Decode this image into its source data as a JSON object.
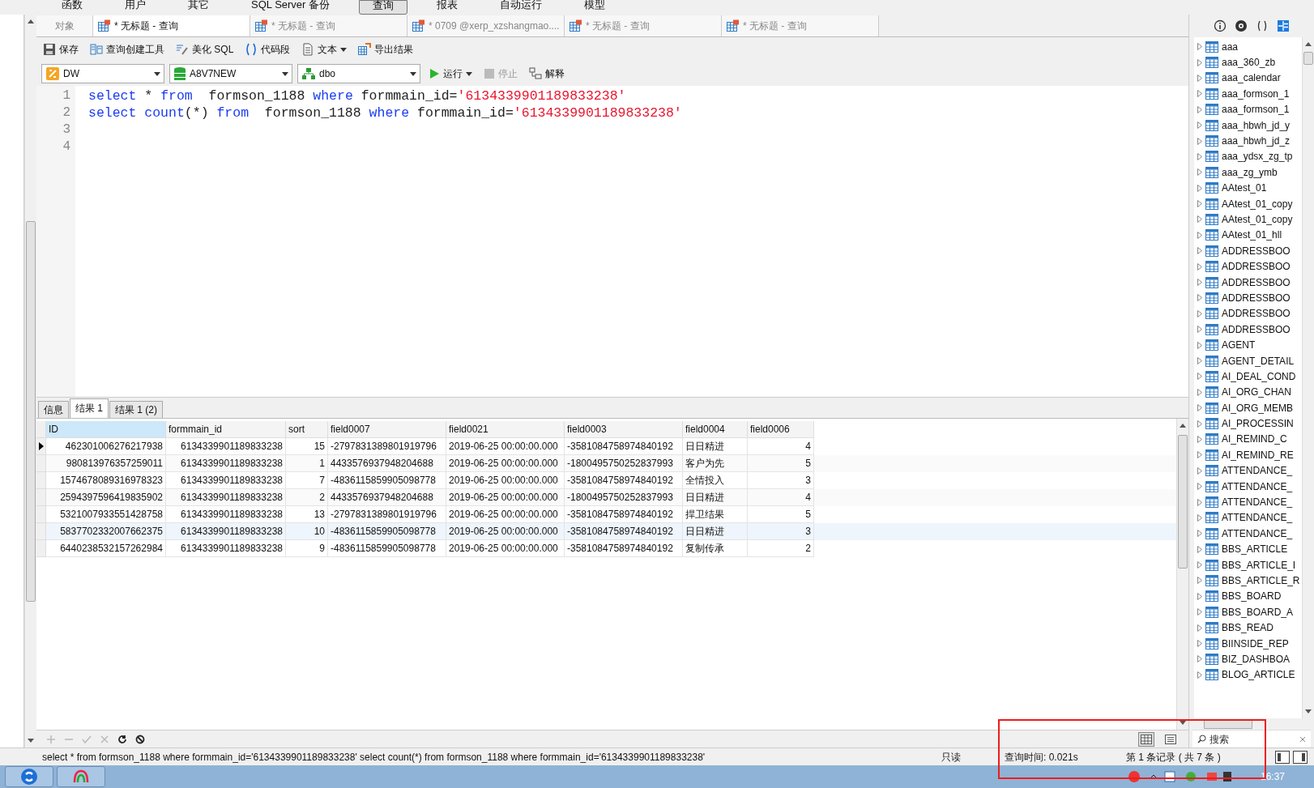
{
  "menu": [
    {
      "label": "函数",
      "selected": false
    },
    {
      "label": "用户",
      "selected": false
    },
    {
      "label": "其它",
      "selected": false
    },
    {
      "label": "SQL Server 备份",
      "selected": false
    },
    {
      "label": "查询",
      "selected": true
    },
    {
      "label": "报表",
      "selected": false
    },
    {
      "label": "自动运行",
      "selected": false
    },
    {
      "label": "模型",
      "selected": false
    }
  ],
  "tabs": [
    {
      "label": "对象",
      "kind": "plain",
      "selected": false
    },
    {
      "label": "* 无标题 - 查询",
      "kind": "query",
      "selected": true
    },
    {
      "label": "* 无标题 - 查询",
      "kind": "query",
      "selected": false
    },
    {
      "label": "* 0709 @xerp_xzshangmao....",
      "kind": "query",
      "selected": false
    },
    {
      "label": "* 无标题 - 查询",
      "kind": "query",
      "selected": false
    },
    {
      "label": "* 无标题 - 查询",
      "kind": "query",
      "selected": false
    }
  ],
  "toolbar": [
    {
      "label": "保存",
      "kind": "save",
      "dropdown": false
    },
    {
      "label": "查询创建工具",
      "kind": "builder",
      "dropdown": false
    },
    {
      "label": "美化 SQL",
      "kind": "beautify",
      "dropdown": false
    },
    {
      "label": "代码段",
      "kind": "snippet",
      "dropdown": false
    },
    {
      "label": "文本",
      "kind": "text",
      "dropdown": true
    },
    {
      "label": "导出结果",
      "kind": "export",
      "dropdown": false
    }
  ],
  "selectors": [
    {
      "value": "DW",
      "kind": "connection"
    },
    {
      "value": "A8V7NEW",
      "kind": "database"
    },
    {
      "value": "dbo",
      "kind": "schema"
    }
  ],
  "actions": [
    {
      "label": "运行",
      "kind": "run",
      "dropdown": true,
      "disabled": false
    },
    {
      "label": "停止",
      "kind": "stop",
      "dropdown": false,
      "disabled": true
    },
    {
      "label": "解释",
      "kind": "explain",
      "dropdown": false,
      "disabled": false
    }
  ],
  "editor": {
    "lines": [
      {
        "number": "1",
        "tokens": [
          {
            "kind": "keyword",
            "text": "select"
          },
          {
            "kind": "plain",
            "text": " * "
          },
          {
            "kind": "keyword",
            "text": "from"
          },
          {
            "kind": "plain",
            "text": "  formson_1188 "
          },
          {
            "kind": "keyword",
            "text": "where"
          },
          {
            "kind": "plain",
            "text": " formmain_id="
          },
          {
            "kind": "string",
            "text": "'6134339901189833238'"
          }
        ]
      },
      {
        "number": "2",
        "tokens": [
          {
            "kind": "keyword",
            "text": "select count"
          },
          {
            "kind": "plain",
            "text": "(*) "
          },
          {
            "kind": "keyword",
            "text": "from"
          },
          {
            "kind": "plain",
            "text": "  formson_1188 "
          },
          {
            "kind": "keyword",
            "text": "where"
          },
          {
            "kind": "plain",
            "text": " formmain_id="
          },
          {
            "kind": "string",
            "text": "'6134339901189833238'"
          }
        ]
      },
      {
        "number": "3"
      },
      {
        "number": "4"
      }
    ]
  },
  "result_tabs": [
    {
      "label": "信息",
      "selected": false
    },
    {
      "label": "结果 1",
      "selected": true
    },
    {
      "label": "结果 1 (2)",
      "selected": false
    }
  ],
  "table": {
    "columns": [
      {
        "label": "ID",
        "selected": true
      },
      {
        "label": "formmain_id",
        "selected": false
      },
      {
        "label": "sort",
        "selected": false
      },
      {
        "label": "field0007",
        "selected": false
      },
      {
        "label": "field0021",
        "selected": false
      },
      {
        "label": "field0003",
        "selected": false
      },
      {
        "label": "field0004",
        "selected": false
      },
      {
        "label": "field0006",
        "selected": false
      }
    ],
    "rows": [
      {
        "selected": true,
        "hovered": false,
        "cells": [
          "462301006276217938",
          "6134339901189833238",
          "15",
          "-2797831389801919796",
          "2019-06-25 00:00:00.000",
          "-3581084758974840192",
          "日日精进",
          "4"
        ]
      },
      {
        "selected": false,
        "hovered": false,
        "cells": [
          "980813976357259011",
          "6134339901189833238",
          "1",
          "4433576937948204688",
          "2019-06-25 00:00:00.000",
          "-1800495750252837993",
          "客户为先",
          "5"
        ]
      },
      {
        "selected": false,
        "hovered": false,
        "cells": [
          "1574678089316978323",
          "6134339901189833238",
          "7",
          "-4836115859905098778",
          "2019-06-25 00:00:00.000",
          "-3581084758974840192",
          "全情投入",
          "3"
        ]
      },
      {
        "selected": false,
        "hovered": false,
        "cells": [
          "2594397596419835902",
          "6134339901189833238",
          "2",
          "4433576937948204688",
          "2019-06-25 00:00:00.000",
          "-1800495750252837993",
          "日日精进",
          "4"
        ]
      },
      {
        "selected": false,
        "hovered": false,
        "cells": [
          "5321007933551428758",
          "6134339901189833238",
          "13",
          "-2797831389801919796",
          "2019-06-25 00:00:00.000",
          "-3581084758974840192",
          "捍卫结果",
          "5"
        ]
      },
      {
        "selected": false,
        "hovered": true,
        "cells": [
          "5837702332007662375",
          "6134339901189833238",
          "10",
          "-4836115859905098778",
          "2019-06-25 00:00:00.000",
          "-3581084758974840192",
          "日日精进",
          "3"
        ]
      },
      {
        "selected": false,
        "hovered": false,
        "cells": [
          "6440238532157262984",
          "6134339901189833238",
          "9",
          "-4836115859905098778",
          "2019-06-25 00:00:00.000",
          "-3581084758974840192",
          "复制传承",
          "2"
        ]
      }
    ]
  },
  "grid_tools": [
    {
      "kind": "add",
      "disabled": true
    },
    {
      "kind": "remove",
      "disabled": true
    },
    {
      "kind": "apply",
      "disabled": true
    },
    {
      "kind": "discard",
      "disabled": true
    },
    {
      "kind": "refresh",
      "disabled": false
    },
    {
      "kind": "stop",
      "disabled": false
    }
  ],
  "view_modes": [
    {
      "kind": "grid",
      "selected": true
    },
    {
      "kind": "form",
      "selected": false
    }
  ],
  "object_tree": {
    "items": [
      "aaa",
      "aaa_360_zb",
      "aaa_calendar",
      "aaa_formson_1",
      "aaa_formson_1",
      "aaa_hbwh_jd_y",
      "aaa_hbwh_jd_z",
      "aaa_ydsx_zg_tp",
      "aaa_zg_ymb",
      "AAtest_01",
      "AAtest_01_copy",
      "AAtest_01_copy",
      "AAtest_01_hll",
      "ADDRESSBOO",
      "ADDRESSBOO",
      "ADDRESSBOO",
      "ADDRESSBOO",
      "ADDRESSBOO",
      "ADDRESSBOO",
      "AGENT",
      "AGENT_DETAIL",
      "AI_DEAL_COND",
      "AI_ORG_CHAN",
      "AI_ORG_MEMB",
      "AI_PROCESSIN",
      "AI_REMIND_C",
      "AI_REMIND_RE",
      "ATTENDANCE_",
      "ATTENDANCE_",
      "ATTENDANCE_",
      "ATTENDANCE_",
      "ATTENDANCE_",
      "BBS_ARTICLE",
      "BBS_ARTICLE_I",
      "BBS_ARTICLE_R",
      "BBS_BOARD",
      "BBS_BOARD_A",
      "BBS_READ",
      "BIINSIDE_REP",
      "BIZ_DASHBOA",
      "BLOG_ARTICLE"
    ],
    "search": {
      "placeholder": "搜索"
    }
  },
  "status_bar": {
    "sql": "select * from  formson_1188 where formmain_id='6134339901189833238' select count(*) from  formson_1188 where formmain_id='6134339901189833238'",
    "mode": "只读",
    "query_time": "查询时间: 0.021s",
    "record": "第 1 条记录 ( 共 7 条 )"
  },
  "taskbar": {
    "time": "16:37"
  }
}
